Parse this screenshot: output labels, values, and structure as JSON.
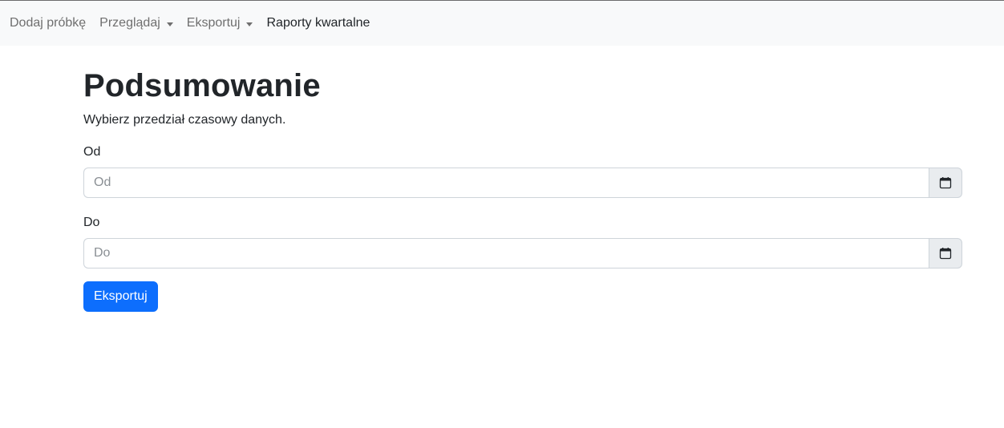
{
  "navbar": {
    "items": [
      {
        "label": "Dodaj próbkę",
        "dropdown": false,
        "active": false
      },
      {
        "label": "Przeglądaj",
        "dropdown": true,
        "active": false
      },
      {
        "label": "Eksportuj",
        "dropdown": true,
        "active": false
      },
      {
        "label": "Raporty kwartalne",
        "dropdown": false,
        "active": true
      }
    ]
  },
  "main": {
    "title": "Podsumowanie",
    "description": "Wybierz przedział czasowy danych.",
    "from_field": {
      "label": "Od",
      "placeholder": "Od",
      "value": "",
      "icon": "calendar-icon"
    },
    "to_field": {
      "label": "Do",
      "placeholder": "Do",
      "value": "",
      "icon": "calendar-icon"
    },
    "export_button": "Eksportuj"
  },
  "colors": {
    "navbar_bg": "#f8f9fa",
    "primary": "#0d6efd",
    "input_addon_bg": "#e9ecef"
  }
}
